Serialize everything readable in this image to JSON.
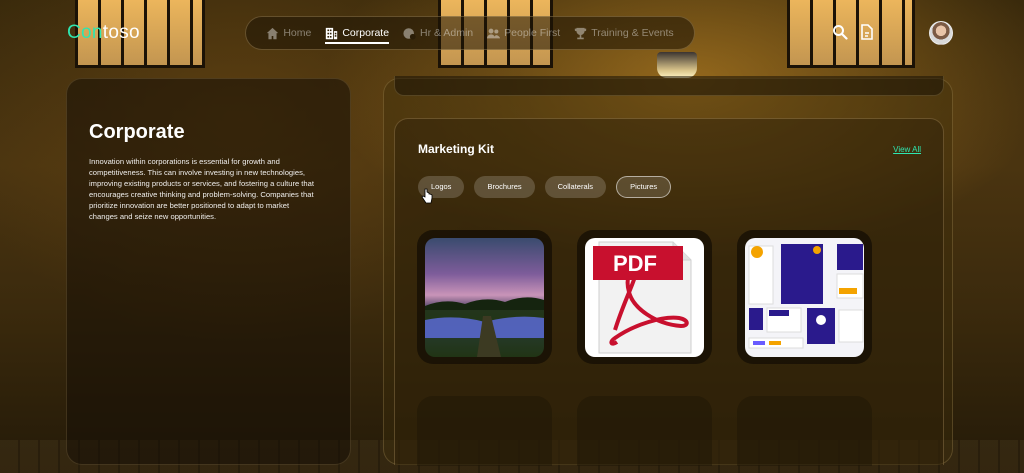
{
  "brand": {
    "name_accent": "Con",
    "name_rest": "toso"
  },
  "nav": {
    "items": [
      {
        "label": "Home",
        "icon": "home-icon",
        "active": false
      },
      {
        "label": "Corporate",
        "icon": "building-icon",
        "active": true
      },
      {
        "label": "Hr & Admin",
        "icon": "hr-admin-icon",
        "active": false
      },
      {
        "label": "People First",
        "icon": "people-icon",
        "active": false
      },
      {
        "label": "Training & Events",
        "icon": "trophy-icon",
        "active": false
      }
    ]
  },
  "header_icons": [
    "search-icon",
    "document-icon"
  ],
  "left_panel": {
    "title": "Corporate",
    "description": "Innovation within corporations is essential for growth and competitiveness. This can involve investing in new technologies, improving existing products or services, and fostering a culture that encourages creative thinking and problem-solving. Companies that prioritize innovation are better positioned to adapt to market changes and seize new opportunities."
  },
  "marketing_kit": {
    "title": "Marketing Kit",
    "view_all": "View All",
    "chips": [
      "Logos",
      "Brochures",
      "Collaterals",
      "Pictures"
    ],
    "thumbnails": [
      {
        "name": "landscape-image"
      },
      {
        "name": "pdf-document",
        "badge": "PDF"
      },
      {
        "name": "brochure-collage"
      }
    ]
  },
  "colors": {
    "accent": "#2ee6b0",
    "pdf_red": "#c8102e"
  }
}
